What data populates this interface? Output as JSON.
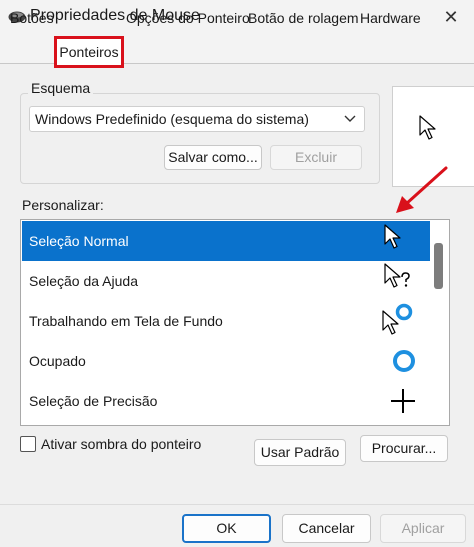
{
  "window": {
    "title": "Propriedades de Mouse",
    "close_glyph": "✕",
    "icon": "mouse-icon"
  },
  "tabs": [
    {
      "label": "Botões",
      "active": false
    },
    {
      "label": "Ponteiros",
      "active": true
    },
    {
      "label": "Opções do Ponteiro",
      "active": false
    },
    {
      "label": "Botão de rolagem",
      "active": false
    },
    {
      "label": "Hardware",
      "active": false
    }
  ],
  "scheme": {
    "label": "Esquema",
    "selected": "Windows Predefinido (esquema do sistema)",
    "save_label": "Salvar como...",
    "delete_label": "Excluir"
  },
  "customize": {
    "label": "Personalizar:",
    "items": [
      {
        "label": "Seleção Normal",
        "icon": "arrow-cursor-icon",
        "selected": true
      },
      {
        "label": "Seleção da Ajuda",
        "icon": "help-cursor-icon",
        "selected": false
      },
      {
        "label": "Trabalhando em Tela de Fundo",
        "icon": "working-cursor-icon",
        "selected": false
      },
      {
        "label": "Ocupado",
        "icon": "busy-cursor-icon",
        "selected": false
      },
      {
        "label": "Seleção de Precisão",
        "icon": "crosshair-cursor-icon",
        "selected": false
      }
    ]
  },
  "shadow": {
    "label": "Ativar sombra do ponteiro",
    "checked": false
  },
  "buttons": {
    "use_default": "Usar Padrão",
    "browse": "Procurar...",
    "ok": "OK",
    "cancel": "Cancelar",
    "apply": "Aplicar"
  },
  "colors": {
    "selection": "#0a72cc",
    "annotation": "#d9111b",
    "busy_ring": "#1e90e0"
  }
}
